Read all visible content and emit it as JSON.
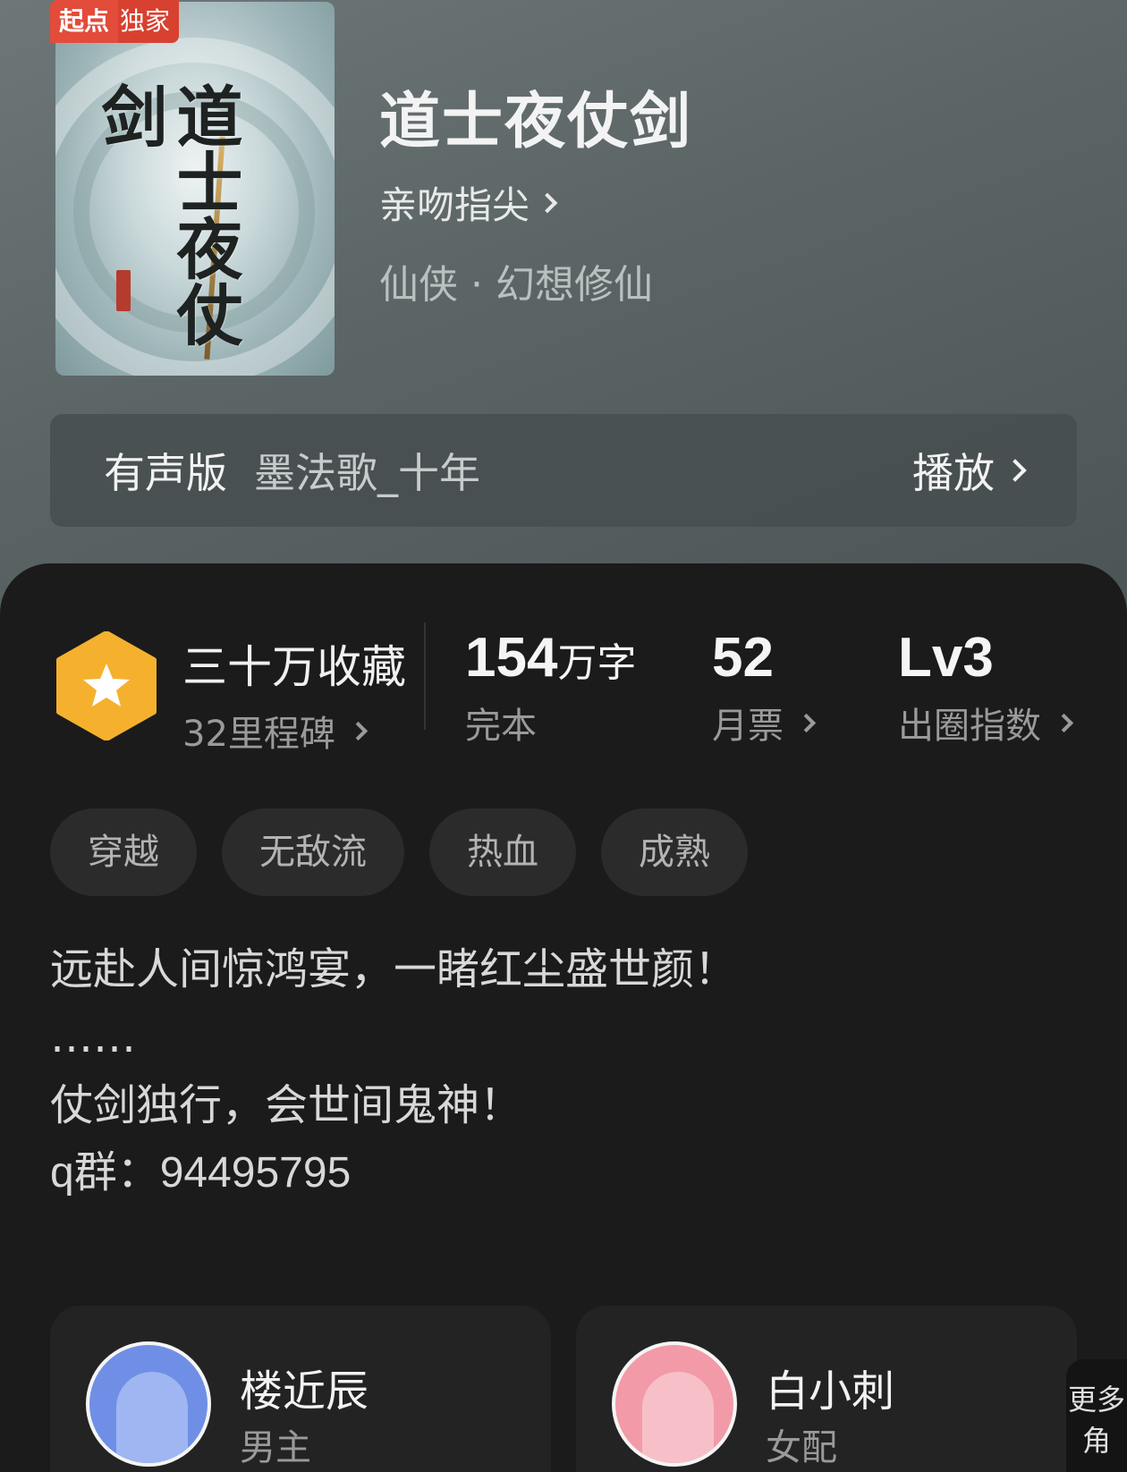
{
  "book": {
    "badge_left": "起点",
    "badge_right": "独家",
    "cover_title": "道士夜仗剑",
    "title": "道士夜仗剑",
    "author": "亲吻指尖",
    "genre": "仙侠 · 幻想修仙"
  },
  "audio": {
    "label": "有声版",
    "narrator": "墨法歌_十年",
    "play_label": "播放"
  },
  "stats": {
    "collections": "三十万收藏",
    "milestones": "32里程碑",
    "word_count_number": "154",
    "word_count_unit": "万字",
    "status": "完本",
    "monthly_votes": "52",
    "monthly_votes_label": "月票",
    "level": "Lv3",
    "level_label": "出圈指数"
  },
  "tags": [
    "穿越",
    "无敌流",
    "热血",
    "成熟"
  ],
  "intro": {
    "line1": "远赴人间惊鸿宴，一睹红尘盛世颜！",
    "line2": "……",
    "line3": "仗剑独行，会世间鬼神！",
    "line4": "q群：94495795"
  },
  "characters": [
    {
      "name": "楼近辰",
      "role": "男主",
      "color": "#6f8fe6"
    },
    {
      "name": "白小刺",
      "role": "女配",
      "color": "#f29aa8"
    }
  ],
  "more_label": "更多角",
  "colors": {
    "accent_hex": "#f5b12e",
    "badge_red": "#e34b3a",
    "panel_bg": "#1b1b1b"
  }
}
